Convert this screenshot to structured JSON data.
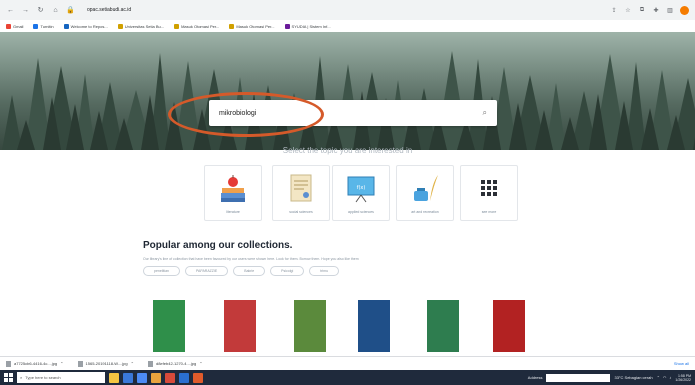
{
  "browser": {
    "url": "opac.setiabudi.ac.id",
    "bookmarks": [
      "Gmail",
      "Turnitin",
      "Welcome to Repos...",
      "Universitas Setia Bu...",
      "Masuk Otomasi Per...",
      "Masuk Otomasi Per...",
      "SYUDIA | Sistem Inf..."
    ]
  },
  "search": {
    "value": "mikrobiologi"
  },
  "topics": {
    "heading": "Select the topic you are interested in",
    "items": [
      {
        "label": "literature",
        "icon": "apple-books-icon"
      },
      {
        "label": "social sciences",
        "icon": "certificate-scroll-icon"
      },
      {
        "label": "applied sciences",
        "icon": "presentation-board-icon"
      },
      {
        "label": "art and recreation",
        "icon": "ink-quill-icon"
      },
      {
        "label": "see more",
        "icon": "grid-dots-icon"
      }
    ]
  },
  "popular": {
    "title": "Popular among our collections.",
    "description": "Our library's line of collection that have been favoured by our users were shown here. Look for them. Borrow them. Hope you also like them",
    "chips": [
      "penelitian",
      "PAPARAZZIE",
      "Bakrie",
      "Psicolgi",
      "trimu"
    ]
  },
  "books": [
    {
      "color": "#2f8f4a"
    },
    {
      "color": "#c23a3a"
    },
    {
      "color": "#5b8a3c"
    },
    {
      "color": "#1f4f88"
    },
    {
      "color": "#2e7d4f"
    },
    {
      "color": "#b22222"
    }
  ],
  "downloads": {
    "items": [
      "a7725cb6-4416-4c....jpg",
      "1565-20191118-W....jpg",
      "d8efeb42-1270-4....jpg"
    ],
    "show_all": "Show all"
  },
  "taskbar": {
    "search_placeholder": "Type here to search",
    "address_label": "Address",
    "weather": "33°C  Sebagian cerah",
    "time": "1:58 PM",
    "date": "1/26/2022"
  },
  "colors": {
    "accent_circle": "#d55a2a",
    "taskbar": "#1f2a3c"
  }
}
